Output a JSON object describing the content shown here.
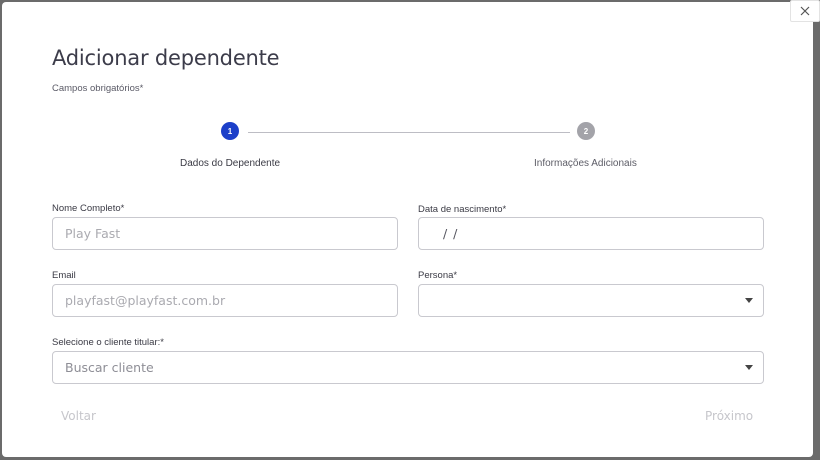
{
  "backdrop": {
    "row_text_left": "",
    "row_text_mid": "",
    "row_text_right": ""
  },
  "modal": {
    "title": "Adicionar dependente",
    "required_note": "Campos obrigatórios*",
    "close_icon": "close-icon",
    "stepper": {
      "steps": [
        {
          "number": "1",
          "label": "Dados do Dependente",
          "state": "active",
          "color": "#1c3fc9"
        },
        {
          "number": "2",
          "label": "Informações Adicionais",
          "state": "inactive",
          "color": "#a3a3a9"
        }
      ]
    },
    "form": {
      "full_name": {
        "label": "Nome Completo*",
        "placeholder": "Play Fast",
        "value": ""
      },
      "birth_date": {
        "label": "Data de nascimento*",
        "value": "/ /"
      },
      "email": {
        "label": "Email",
        "placeholder": "playfast@playfast.com.br",
        "value": ""
      },
      "persona": {
        "label": "Persona*",
        "value": ""
      },
      "client": {
        "label": "Selecione o cliente titular:*",
        "placeholder": "Buscar cliente",
        "value": ""
      }
    },
    "footer": {
      "back_label": "Voltar",
      "next_label": "Próximo"
    }
  }
}
